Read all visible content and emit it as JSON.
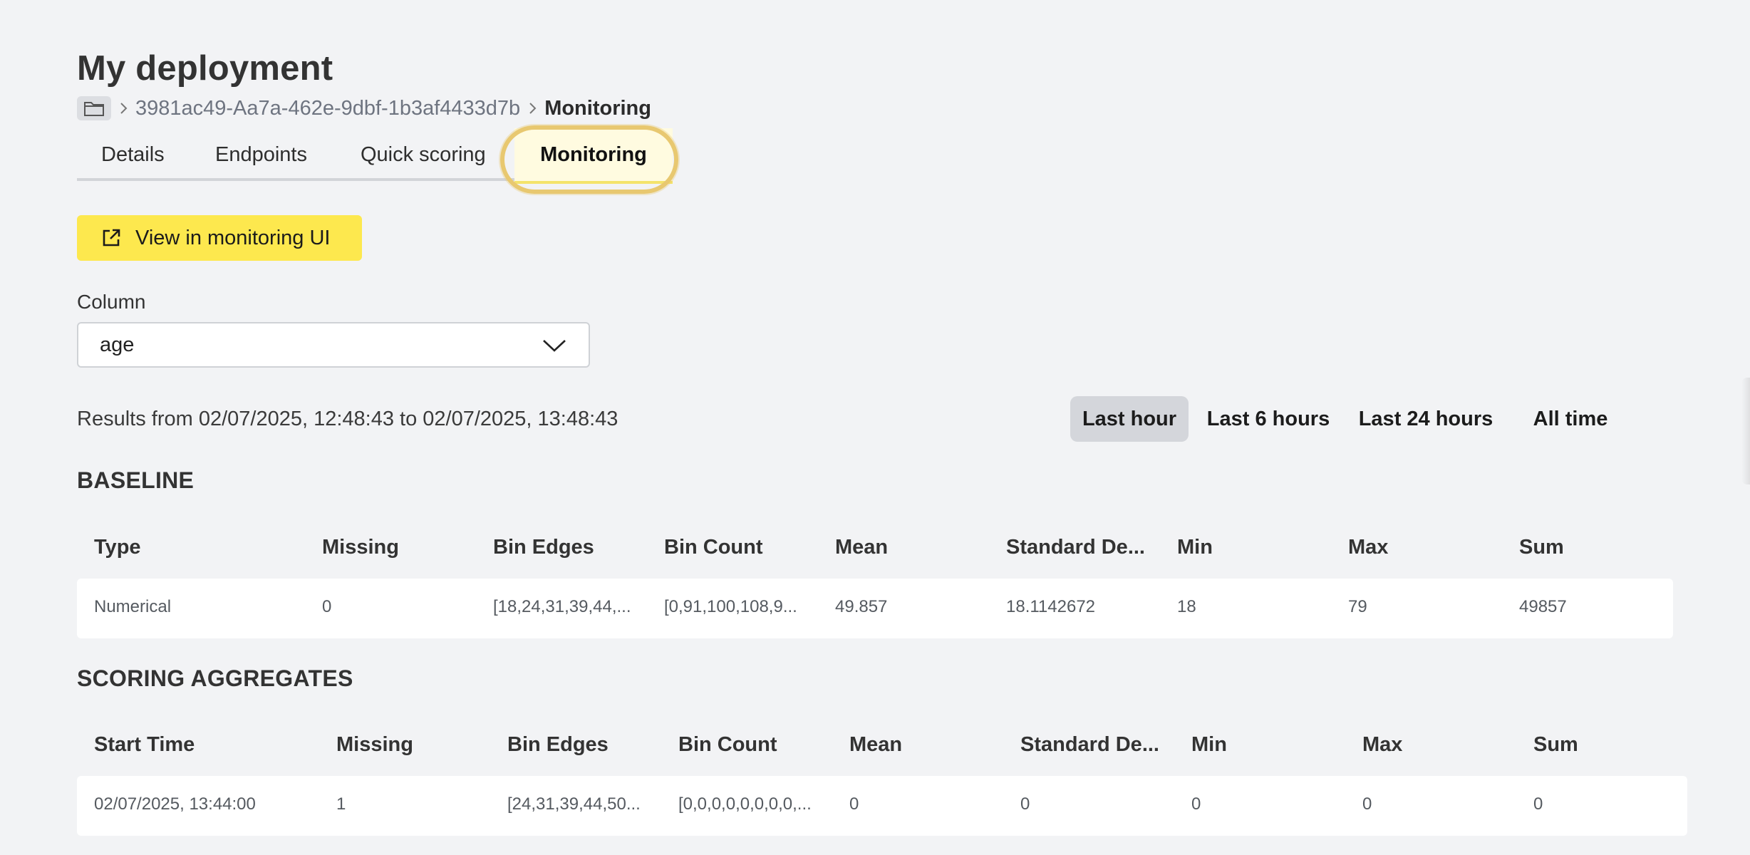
{
  "header": {
    "title": "My deployment"
  },
  "breadcrumb": {
    "folder_icon": "folder-icon",
    "id": "3981ac49-Aa7a-462e-9dbf-1b3af4433d7b",
    "current": "Monitoring"
  },
  "tabs": [
    {
      "label": "Details",
      "active": false
    },
    {
      "label": "Endpoints",
      "active": false
    },
    {
      "label": "Quick scoring",
      "active": false
    },
    {
      "label": "Monitoring",
      "active": true
    }
  ],
  "actions": {
    "view_monitoring_label": "View in monitoring UI",
    "icon": "external-link-icon"
  },
  "column_select": {
    "label": "Column",
    "value": "age"
  },
  "results": {
    "text": "Results from 02/07/2025, 12:48:43 to 02/07/2025, 13:48:43"
  },
  "time_ranges": [
    {
      "label": "Last hour",
      "active": true
    },
    {
      "label": "Last 6 hours",
      "active": false
    },
    {
      "label": "Last 24 hours",
      "active": false
    },
    {
      "label": "All time",
      "active": false
    }
  ],
  "baseline": {
    "title": "BASELINE",
    "columns": [
      "Type",
      "Missing",
      "Bin Edges",
      "Bin Count",
      "Mean",
      "Standard De...",
      "Min",
      "Max",
      "Sum"
    ],
    "rows": [
      [
        "Numerical",
        "0",
        "[18,24,31,39,44,...",
        "[0,91,100,108,9...",
        "49.857",
        "18.1142672",
        "18",
        "79",
        "49857"
      ]
    ]
  },
  "scoring": {
    "title": "SCORING AGGREGATES",
    "columns": [
      "Start Time",
      "Missing",
      "Bin Edges",
      "Bin Count",
      "Mean",
      "Standard De...",
      "Min",
      "Max",
      "Sum"
    ],
    "rows": [
      [
        "02/07/2025, 13:44:00",
        "1",
        "[24,31,39,44,50...",
        "[0,0,0,0,0,0,0,0,...",
        "0",
        "0",
        "0",
        "0",
        "0"
      ]
    ]
  },
  "colors": {
    "accent_yellow": "#fde84e",
    "background": "#f2f3f5",
    "highlight_ring": "#e8c870"
  }
}
